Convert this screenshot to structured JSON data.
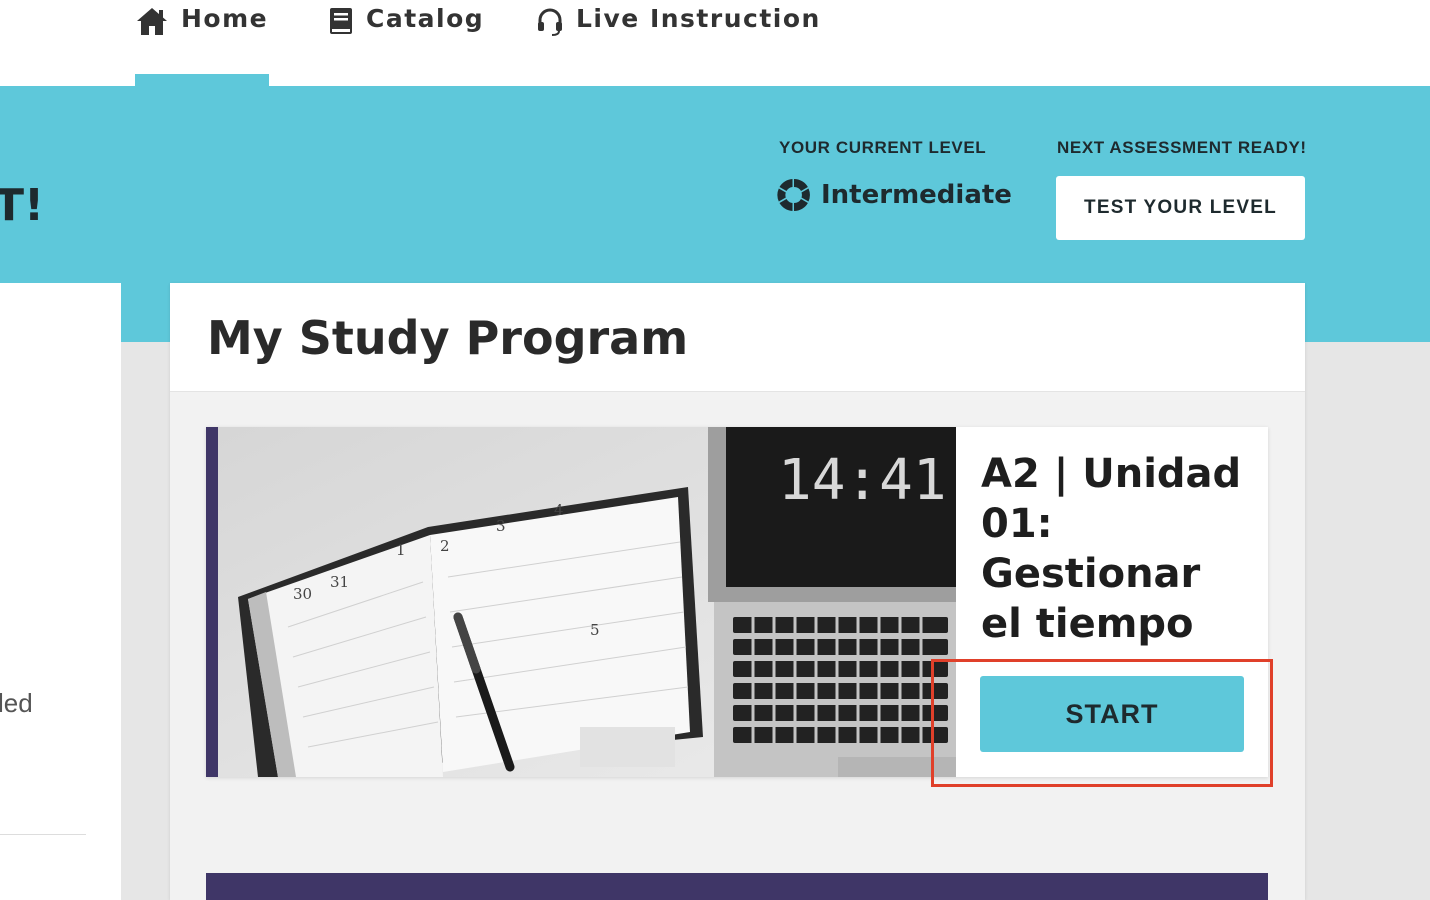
{
  "nav": {
    "items": [
      {
        "label": "Home",
        "icon": "home-icon",
        "active": true
      },
      {
        "label": "Catalog",
        "icon": "book-icon",
        "active": false
      },
      {
        "label": "Live Instruction",
        "icon": "headset-icon",
        "active": false
      }
    ]
  },
  "banner": {
    "title_fragment": "T!",
    "level_label": "YOUR CURRENT LEVEL",
    "level_value": "Intermediate",
    "assessment_label": "NEXT ASSESSMENT READY!",
    "test_button": "TEST YOUR LEVEL"
  },
  "left_panel": {
    "text_fragment": "led"
  },
  "main": {
    "title": "My Study Program",
    "course": {
      "title": "A2 | Unidad 01: Gestionar el tiempo",
      "start_button": "START",
      "image_clock_text": "14:41",
      "image_page_numbers": [
        "30",
        "31",
        "1",
        "2",
        "3",
        "4",
        "5"
      ]
    }
  },
  "colors": {
    "accent_teal": "#5ec8da",
    "accent_purple": "#3f3667",
    "highlight_red": "#e0402a"
  }
}
